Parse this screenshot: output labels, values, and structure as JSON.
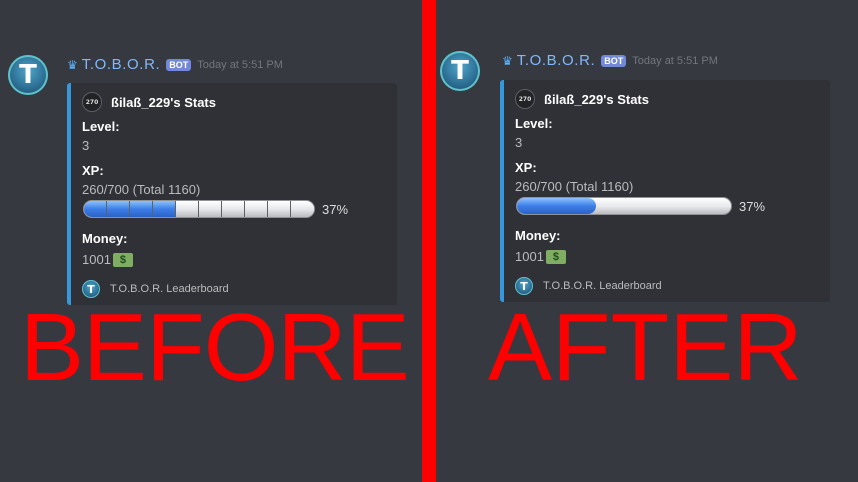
{
  "colors": {
    "background": "#36393f",
    "divider": "#ff0000",
    "embed_border": "#3498db",
    "bot_tag": "#7289da",
    "progress_fill": "#3d7ee8",
    "label_red": "#ff0000"
  },
  "panels": [
    {
      "bot": {
        "avatar_letter": "T",
        "crown_icon": "crown-icon",
        "name": "T.O.B.O.R.",
        "tag": "BOT",
        "timestamp": "Today at 5:51 PM"
      },
      "embed": {
        "author_icon_text": "270",
        "author": "ßilaß_229's Stats",
        "level_label": "Level:",
        "level_value": "3",
        "xp_label": "XP:",
        "xp_value": "260/700 (Total 1160)",
        "progress_fraction": 0.37,
        "progress_percent": "37%",
        "progress_style": "segmented",
        "money_label": "Money:",
        "money_value": "1001",
        "money_icon": "$",
        "footer_icon_letter": "T",
        "footer": "T.O.B.O.R. Leaderboard"
      },
      "caption": "BEFORE"
    },
    {
      "bot": {
        "avatar_letter": "T",
        "crown_icon": "crown-icon",
        "name": "T.O.B.O.R.",
        "tag": "BOT",
        "timestamp": "Today at 5:51 PM"
      },
      "embed": {
        "author_icon_text": "270",
        "author": "ßilaß_229's Stats",
        "level_label": "Level:",
        "level_value": "3",
        "xp_label": "XP:",
        "xp_value": "260/700 (Total 1160)",
        "progress_fraction": 0.37,
        "progress_percent": "37%",
        "progress_style": "smooth",
        "money_label": "Money:",
        "money_value": "1001",
        "money_icon": "$",
        "footer_icon_letter": "T",
        "footer": "T.O.B.O.R. Leaderboard"
      },
      "caption": "AFTER"
    }
  ]
}
